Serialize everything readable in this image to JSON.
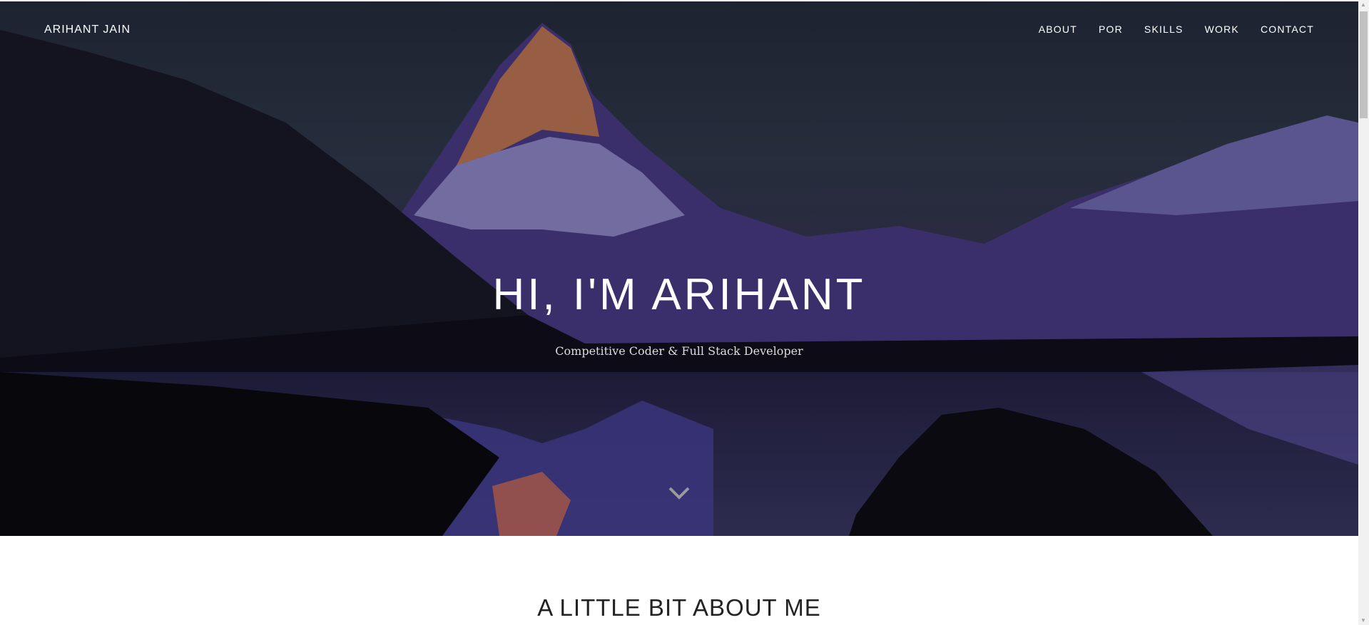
{
  "nav": {
    "brand": "ARIHANT JAIN",
    "items": [
      {
        "label": "ABOUT"
      },
      {
        "label": "POR"
      },
      {
        "label": "SKILLS"
      },
      {
        "label": "WORK"
      },
      {
        "label": "CONTACT"
      }
    ]
  },
  "hero": {
    "title": "HI, I'M ARIHANT",
    "subtitle": "Competitive Coder & Full Stack Developer",
    "scroll_icon": "chevron-down-icon"
  },
  "about": {
    "heading": "A LITTLE BIT ABOUT ME"
  }
}
